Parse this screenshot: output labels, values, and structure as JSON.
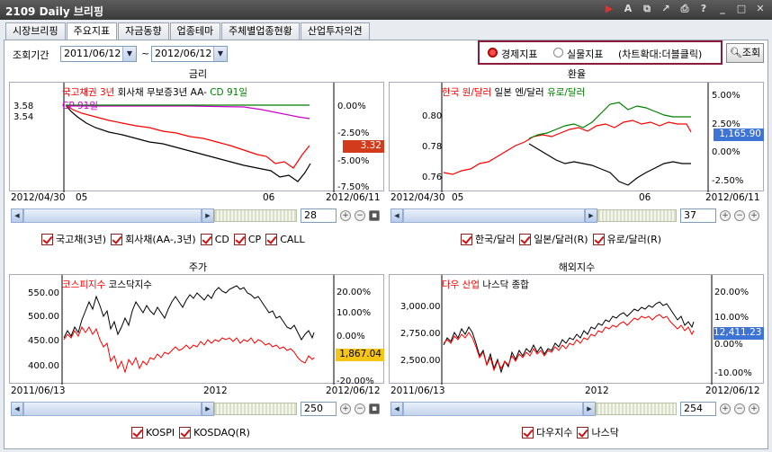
{
  "window": {
    "title": "2109  Daily 브리핑"
  },
  "tabs": [
    {
      "label": "시장브리핑"
    },
    {
      "label": "주요지표"
    },
    {
      "label": "자금동향"
    },
    {
      "label": "업종테마"
    },
    {
      "label": "주체별업종현황"
    },
    {
      "label": "산업투자의견"
    }
  ],
  "controls": {
    "period_label": "조회기간",
    "date_from": "2011/06/12",
    "tilde": "~",
    "date_to": "2012/06/12",
    "radio_economic": "경제지표",
    "radio_real": "실물지표",
    "hint": "(차트확대:더블클릭)",
    "search_label": "조회"
  },
  "charts": {
    "rates": {
      "title": "금리",
      "legend": [
        "국고채권 3년",
        "회사채 무보증3년 AA-",
        "CD 91일",
        "CP 91일"
      ],
      "right_ticks": [
        "0.00%",
        "-2.50%",
        "-5.00%",
        "-7.50%"
      ],
      "left_ticks": [
        "3.58",
        "3.54"
      ],
      "badge": "3.32",
      "x_start": "2012/04/30",
      "x_mid1": "05",
      "x_mid2": "06",
      "x_end": "2012/06/11",
      "zoom": "28",
      "checks": [
        "국고채(3년)",
        "회사채(AA-,3년)",
        "CD",
        "CP",
        "CALL"
      ]
    },
    "fx": {
      "title": "환율",
      "legend": [
        "한국 원/달러",
        "일본 엔/달러",
        "유로/달러"
      ],
      "right_ticks": [
        "5.00%",
        "2.50%",
        "0.00%",
        "-2.50%"
      ],
      "left_ticks": [
        "0.80",
        "0.78",
        "0.76"
      ],
      "badge": "1,165.90",
      "x_start": "2012/04/30",
      "x_mid1": "05",
      "x_mid2": "06",
      "x_end": "2012/06/11",
      "zoom": "37",
      "checks": [
        "한국/달러",
        "일본/달러(R)",
        "유로/달러(R)"
      ]
    },
    "stock": {
      "title": "주가",
      "legend": [
        "코스피지수",
        "코스닥지수"
      ],
      "right_ticks": [
        "20.00%",
        "10.00%",
        "0.00%",
        "-10.00%",
        "-20.00%"
      ],
      "left_ticks": [
        "550.00",
        "500.00",
        "450.00",
        "400.00"
      ],
      "badge": "1,867.04",
      "x_start": "2011/06/13",
      "x_mid": "2012",
      "x_end": "2012/06/12",
      "zoom": "250",
      "checks": [
        "KOSPI",
        "KOSDAQ(R)"
      ]
    },
    "overseas": {
      "title": "해외지수",
      "legend": [
        "다우 산업",
        "나스닥 종합"
      ],
      "right_ticks": [
        "20.00%",
        "10.00%",
        "0.00%",
        "-10.00%"
      ],
      "left_ticks": [
        "3,000.00",
        "2,750.00",
        "2,500.00"
      ],
      "badge": "12,411.23",
      "x_start": "2011/06/13",
      "x_mid": "2012",
      "x_end": "2012/06/12",
      "zoom": "254",
      "checks": [
        "다우지수",
        "나스닥"
      ]
    }
  },
  "colors": {
    "red": "#ff0000",
    "black": "#000000",
    "green": "#008000",
    "magenta": "#cc00cc",
    "badge_red": "#d23b1c",
    "badge_blue": "#3d74d6",
    "badge_yellow": "#f5c518"
  }
}
